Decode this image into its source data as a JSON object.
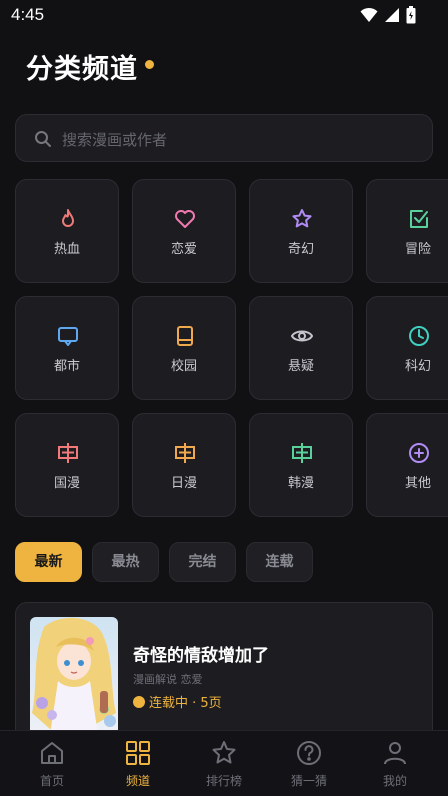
{
  "status_bar": {
    "time": "4:45"
  },
  "header": {
    "title": "分类频道"
  },
  "search": {
    "placeholder": "搜索漫画或作者"
  },
  "categories": [
    {
      "label": "热血",
      "icon": "fire-icon",
      "color": "#f07a78"
    },
    {
      "label": "恋爱",
      "icon": "heart-icon",
      "color": "#f07ab0"
    },
    {
      "label": "奇幻",
      "icon": "star-icon",
      "color": "#b08cf5"
    },
    {
      "label": "冒险",
      "icon": "checkbox-icon",
      "color": "#5ad09a"
    },
    {
      "label": "都市",
      "icon": "monitor-icon",
      "color": "#5fa8f0"
    },
    {
      "label": "校园",
      "icon": "book-icon",
      "color": "#f0a84f"
    },
    {
      "label": "悬疑",
      "icon": "eye-icon",
      "color": "#c4c4cc"
    },
    {
      "label": "科幻",
      "icon": "clock-icon",
      "color": "#3fd0c0"
    },
    {
      "label": "国漫",
      "icon": "flag-cn-icon",
      "color": "#f07a78"
    },
    {
      "label": "日漫",
      "icon": "flag-jp-icon",
      "color": "#f0a84f"
    },
    {
      "label": "韩漫",
      "icon": "flag-kr-icon",
      "color": "#5ad09a"
    },
    {
      "label": "其他",
      "icon": "plus-circle-icon",
      "color": "#b08cf5"
    }
  ],
  "filters": [
    {
      "label": "最新",
      "active": true
    },
    {
      "label": "最热",
      "active": false
    },
    {
      "label": "完结",
      "active": false
    },
    {
      "label": "连载",
      "active": false
    }
  ],
  "manga_list": [
    {
      "title": "奇怪的情敌增加了",
      "tags": "漫画解说 恋爱",
      "status": "连载中 · 5页"
    }
  ],
  "bottom_nav": [
    {
      "label": "首页",
      "icon": "home-icon",
      "active": false
    },
    {
      "label": "频道",
      "icon": "grid-icon",
      "active": true
    },
    {
      "label": "排行榜",
      "icon": "star-outline-icon",
      "active": false
    },
    {
      "label": "猜一猜",
      "icon": "question-icon",
      "active": false
    },
    {
      "label": "我的",
      "icon": "user-icon",
      "active": false
    }
  ],
  "colors": {
    "accent": "#efb43f",
    "background": "#111114",
    "card": "#1c1c21"
  }
}
